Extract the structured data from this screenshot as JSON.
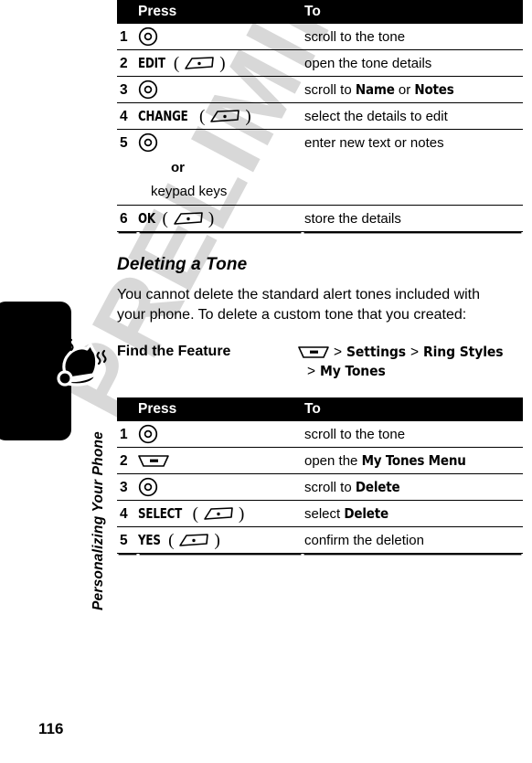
{
  "page": {
    "number": "116",
    "chapter_label": "Personalizing Your Phone",
    "watermark": "PRELIMINARY",
    "tab_icon": "ringing-bell-icon"
  },
  "table_top": {
    "headers": {
      "num": "",
      "press": "Press",
      "to": "To"
    },
    "rows": [
      {
        "num": "1",
        "press_icon": "nav-key-icon",
        "press_label": "",
        "to": "scroll to the tone"
      },
      {
        "num": "2",
        "press_icon": "soft-key-icon",
        "press_label": "EDIT",
        "to": "open the tone details"
      },
      {
        "num": "3",
        "press_icon": "nav-key-icon",
        "press_label": "",
        "to": "scroll to ",
        "to_term1": "Name",
        "to_mid": " or ",
        "to_term2": "Notes"
      },
      {
        "num": "4",
        "press_icon": "soft-key-icon",
        "press_label": "CHANGE",
        "to": "select the details to edit"
      },
      {
        "num": "5",
        "press_icon": "nav-key-icon",
        "press_label": "",
        "to": "enter new text or notes",
        "or_label": "or",
        "alt_label": "keypad keys"
      },
      {
        "num": "6",
        "press_icon": "soft-key-icon",
        "press_label": "OK",
        "to": "store the details"
      }
    ]
  },
  "section": {
    "heading": "Deleting a Tone",
    "body": "You cannot delete the standard alert tones included with your phone. To delete a custom tone that you created:"
  },
  "find_feature": {
    "label": "Find the Feature",
    "key_icon": "menu-key-icon",
    "path_line1_sep1": ">",
    "path_line1_item1": "Settings",
    "path_line1_sep2": ">",
    "path_line1_item2": "Ring Styles",
    "path_line2_sep": ">",
    "path_line2_item": "My Tones"
  },
  "table_bottom": {
    "headers": {
      "num": "",
      "press": "Press",
      "to": "To"
    },
    "rows": [
      {
        "num": "1",
        "press_icon": "nav-key-icon",
        "press_label": "",
        "to": "scroll to the tone"
      },
      {
        "num": "2",
        "press_icon": "menu-key-icon",
        "press_label": "",
        "to": "open the ",
        "to_term1": "My Tones Menu"
      },
      {
        "num": "3",
        "press_icon": "nav-key-icon",
        "press_label": "",
        "to": "scroll to ",
        "to_term1": "Delete"
      },
      {
        "num": "4",
        "press_icon": "soft-key-icon",
        "press_label": "SELECT",
        "to": "select ",
        "to_term1": "Delete"
      },
      {
        "num": "5",
        "press_icon": "soft-key-icon",
        "press_label": "YES",
        "to": "confirm the deletion"
      }
    ]
  },
  "colors": {
    "header_bg": "#000000",
    "header_text": "#ffffff",
    "rule": "#000000",
    "watermark": "#d8d8d8"
  }
}
